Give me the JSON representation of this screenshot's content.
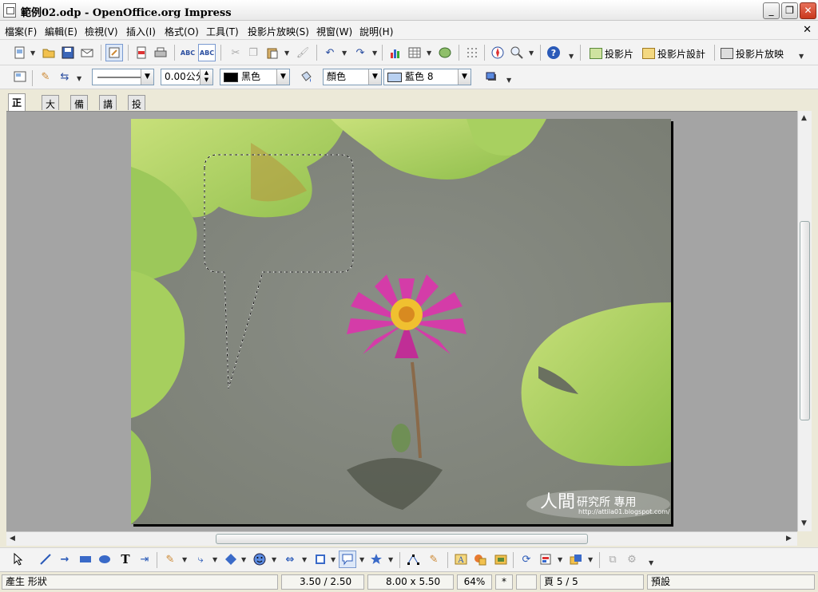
{
  "window": {
    "title": "範例02.odp - OpenOffice.org Impress",
    "min_label": "_",
    "max_label": "❐",
    "close_label": "✕"
  },
  "menu": {
    "items": [
      "檔案(F)",
      "編輯(E)",
      "檢視(V)",
      "插入(I)",
      "格式(O)",
      "工具(T)",
      "投影片放映(S)",
      "視窗(W)",
      "說明(H)"
    ],
    "close_doc": "✕"
  },
  "toolbar1": {
    "slide_label": "投影片",
    "slide_design_label": "投影片設計",
    "slide_show_label": "投影片放映"
  },
  "toolbar2": {
    "line_width": "0.00公分",
    "line_color": "黑色",
    "area_style": "顏色",
    "area_color": "藍色 8",
    "colors": {
      "line": "#000000",
      "area": "#b8d0f0"
    }
  },
  "tabs": [
    "正常",
    "大綱",
    "備註",
    "講義",
    "投影片瀏覽"
  ],
  "slide": {
    "watermark_main": "人間",
    "watermark_sub": "研究所 專用",
    "watermark_url": "http://attila01.blogspot.com/"
  },
  "status": {
    "message": "產生 形狀",
    "position": "3.50 / 2.50",
    "size": "8.00 x 5.50",
    "zoom": "64%",
    "modified": "*",
    "page": "頁 5 / 5",
    "layout": "預設"
  }
}
